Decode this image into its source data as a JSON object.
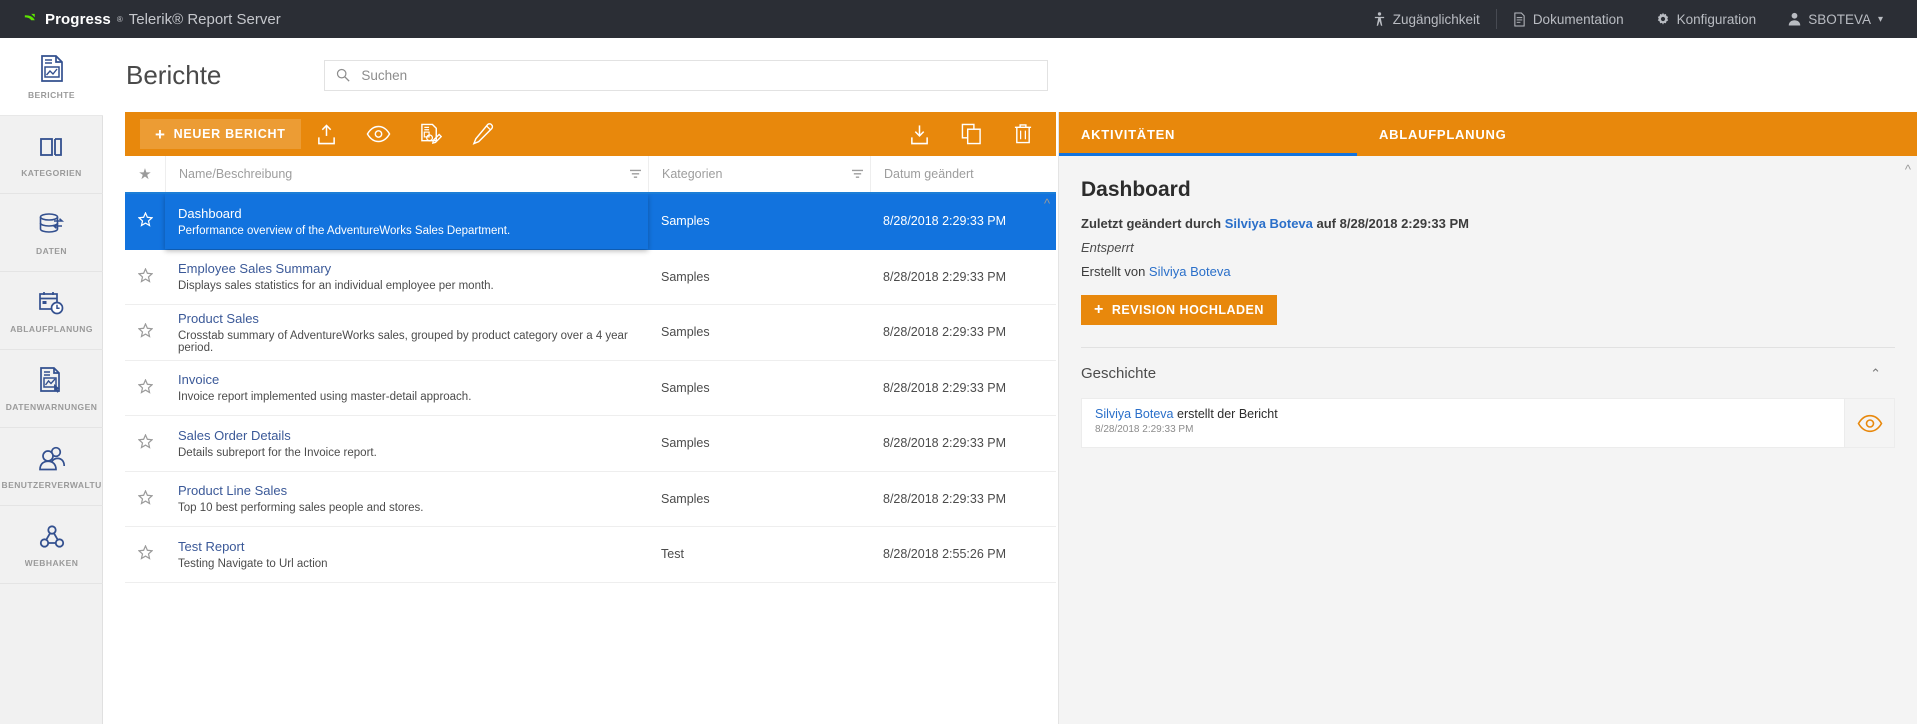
{
  "topbar": {
    "brand": {
      "progress": "Progress",
      "sup": "®",
      "rest": "Telerik® Report Server"
    },
    "nav": [
      {
        "label": "Zugänglichkeit",
        "icon": "accessibility-icon"
      },
      {
        "label": "Dokumentation",
        "icon": "document-icon"
      },
      {
        "label": "Konfiguration",
        "icon": "gear-icon"
      },
      {
        "label": "SBOTEVA",
        "icon": "user-icon",
        "caret": "▾"
      }
    ]
  },
  "sidebar": {
    "items": [
      {
        "label": "BERICHTE",
        "icon": "report-icon",
        "active": true
      },
      {
        "label": "KATEGORIEN",
        "icon": "categories-icon",
        "active": false
      },
      {
        "label": "DATEN",
        "icon": "data-icon",
        "active": false
      },
      {
        "label": "ABLAUFPLANUNG",
        "icon": "schedule-icon",
        "active": false
      },
      {
        "label": "DATENWARNUNGEN",
        "icon": "data-alerts-icon",
        "active": false
      },
      {
        "label": "BENUTZERVERWALTUNG",
        "icon": "users-icon",
        "active": false
      },
      {
        "label": "WEBHAKEN",
        "icon": "webhook-icon",
        "active": false
      }
    ]
  },
  "page": {
    "title": "Berichte"
  },
  "search": {
    "value": "",
    "placeholder": "Suchen"
  },
  "toolbar": {
    "new_report_label": "NEUER BERICHT",
    "new_report_plus": "+",
    "left_icons": [
      {
        "name": "upload-icon"
      },
      {
        "name": "preview-eye-icon"
      },
      {
        "name": "parameters-edit-icon"
      },
      {
        "name": "design-pencil-icon"
      }
    ],
    "right_icons": [
      {
        "name": "download-icon"
      },
      {
        "name": "copy-icon"
      },
      {
        "name": "delete-trash-icon"
      }
    ]
  },
  "table": {
    "headers": {
      "star": "★",
      "name": "Name/Beschreibung",
      "category": "Kategorien",
      "date": "Datum geändert"
    },
    "rows": [
      {
        "title": "Dashboard",
        "desc": "Performance overview of the AdventureWorks Sales Department.",
        "category": "Samples",
        "date": "8/28/2018 2:29:33 PM",
        "selected": true
      },
      {
        "title": "Employee Sales Summary",
        "desc": "Displays sales statistics for an individual employee per month.",
        "category": "Samples",
        "date": "8/28/2018 2:29:33 PM",
        "selected": false
      },
      {
        "title": "Product Sales",
        "desc": "Crosstab summary of AdventureWorks sales, grouped by product category over a 4 year period.",
        "category": "Samples",
        "date": "8/28/2018 2:29:33 PM",
        "selected": false
      },
      {
        "title": "Invoice",
        "desc": "Invoice report implemented using master-detail approach.",
        "category": "Samples",
        "date": "8/28/2018 2:29:33 PM",
        "selected": false
      },
      {
        "title": "Sales Order Details",
        "desc": "Details subreport for the Invoice report.",
        "category": "Samples",
        "date": "8/28/2018 2:29:33 PM",
        "selected": false
      },
      {
        "title": "Product Line Sales",
        "desc": "Top 10 best performing sales people and stores.",
        "category": "Samples",
        "date": "8/28/2018 2:29:33 PM",
        "selected": false
      },
      {
        "title": "Test Report",
        "desc": "Testing Navigate to Url action",
        "category": "Test",
        "date": "8/28/2018 2:55:26 PM",
        "selected": false
      }
    ]
  },
  "detail": {
    "tabs": [
      {
        "label": "AKTIVITÄTEN",
        "active": true
      },
      {
        "label": "ABLAUFPLANUNG",
        "active": false
      }
    ],
    "title": "Dashboard",
    "modified_prefix": "Zuletzt geändert durch ",
    "modified_user": "Silviya Boteva",
    "modified_middle": " auf ",
    "modified_date": "8/28/2018 2:29:33 PM",
    "lock_status": "Entsperrt",
    "created_prefix": "Erstellt von ",
    "created_user": "Silviya Boteva",
    "upload_button": "REVISION HOCHLADEN",
    "upload_plus": "+",
    "history_title": "Geschichte",
    "history_chevron": "⌃",
    "history": [
      {
        "user": "Silviya Boteva",
        "action": " erstellt der Bericht",
        "timestamp": "8/28/2018 2:29:33 PM",
        "eye_icon": "preview-eye-icon"
      }
    ]
  },
  "colors": {
    "accent_orange": "#e8880c",
    "selection_blue": "#1273de",
    "topbar_dark": "#2b2e35",
    "link_blue": "#3b5998",
    "icon_blue": "#33508f"
  }
}
